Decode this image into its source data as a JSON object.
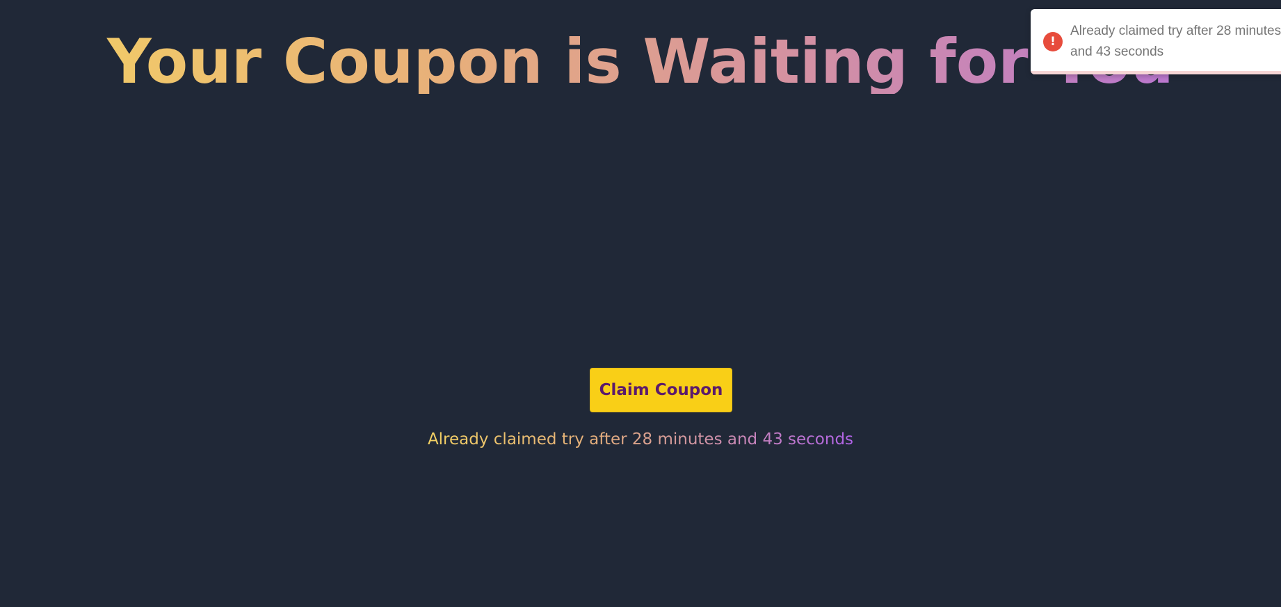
{
  "page": {
    "headline": "Your Coupon is Waiting for You",
    "claim_button_label": "Claim Coupon",
    "status_message": "Already claimed try after 28 minutes and 43 seconds"
  },
  "toast": {
    "type": "error",
    "icon": "exclamation-icon",
    "icon_glyph": "!",
    "message": "Already claimed try after 28 minutes and 43 seconds",
    "progress_remaining": 1.0
  },
  "colors": {
    "background": "#202837",
    "button_bg": "#f9cf17",
    "button_text": "#5b1a6c",
    "gradient_start": "#f4d263",
    "gradient_end": "#b16ede",
    "toast_error": "#e74c3c"
  }
}
